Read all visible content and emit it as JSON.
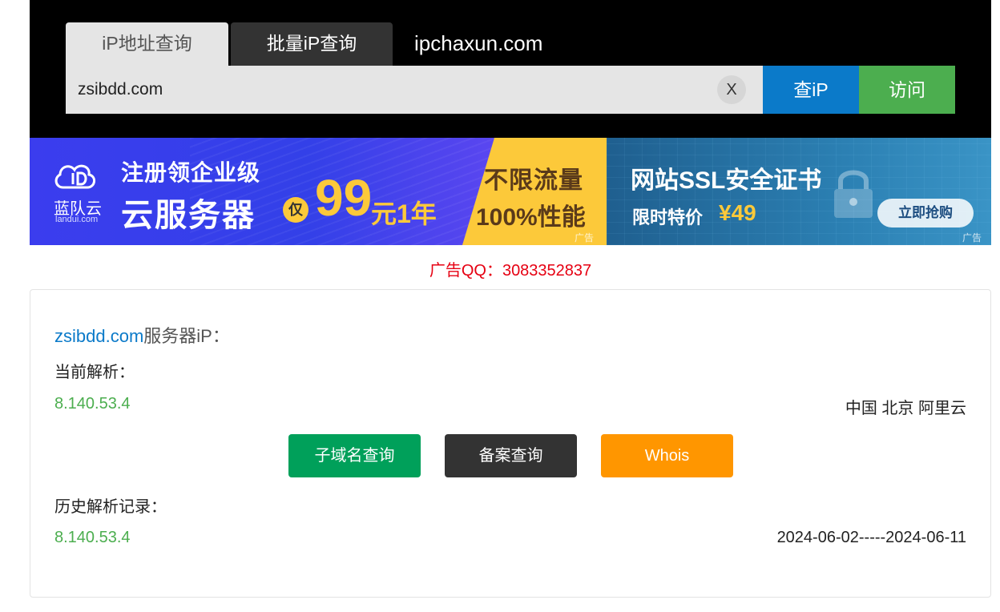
{
  "header": {
    "tabs": [
      {
        "label": "iP地址查询",
        "active": true
      },
      {
        "label": "批量iP查询",
        "active": false
      }
    ],
    "site_name": "ipchaxun.com",
    "search": {
      "value": "zsibdd.com",
      "clear_label": "X"
    },
    "query_button": "查iP",
    "visit_button": "访问"
  },
  "banner": {
    "brand_name": "蓝队云",
    "brand_url": "landui.com",
    "line1": "注册领企业级",
    "line2": "云服务器",
    "badge": "仅",
    "price": "99",
    "price_unit": "元1年",
    "yellow_line1": "不限流量",
    "yellow_line2": "100%性能",
    "ad_tag": "广告",
    "ssl_title": "网站SSL安全证书",
    "ssl_promo": "限时特价",
    "ssl_price": "¥49",
    "grab_button": "立即抢购"
  },
  "ad_qq": "广告QQ：3083352837",
  "result": {
    "domain": "zsibdd.com",
    "title_suffix": "服务器iP：",
    "current_label": "当前解析：",
    "current_ip": "8.140.53.4",
    "current_location": "中国 北京 阿里云",
    "buttons": {
      "subdomain": "子域名查询",
      "icp": "备案查询",
      "whois": "Whois"
    },
    "history_label": "历史解析记录：",
    "history": [
      {
        "ip": "8.140.53.4",
        "range": "2024-06-02-----2024-06-11"
      }
    ]
  },
  "colors": {
    "query_blue": "#0b7ac9",
    "visit_green": "#4cae4f",
    "ad_red": "#e60012",
    "subdomain_green": "#00a05a",
    "icp_dark": "#333333",
    "whois_orange": "#ff9600"
  }
}
